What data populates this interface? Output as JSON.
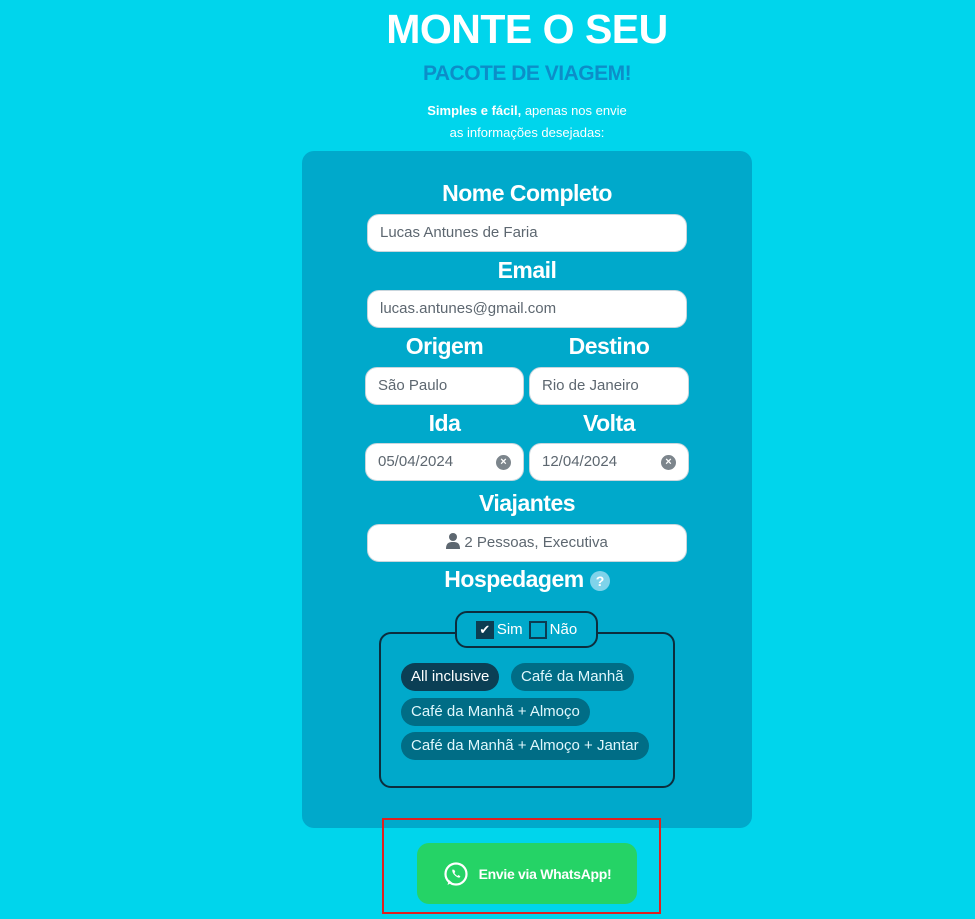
{
  "header": {
    "title": "MONTE O SEU",
    "subtitle": "PACOTE DE VIAGEM!",
    "tagline_bold": "Simples e fácil,",
    "tagline_rest": " apenas nos envie",
    "tagline_line2": "as informações desejadas:"
  },
  "form": {
    "name_label": "Nome Completo",
    "name_value": "Lucas Antunes de Faria",
    "email_label": "Email",
    "email_value": "lucas.antunes@gmail.com",
    "origin_label": "Origem",
    "origin_value": "São Paulo",
    "destination_label": "Destino",
    "destination_value": "Rio de Janeiro",
    "departure_label": "Ida",
    "departure_value": "05/04/2024",
    "return_label": "Volta",
    "return_value": "12/04/2024",
    "travelers_label": "Viajantes",
    "travelers_value": "2 Pessoas, Executiva",
    "lodging_label": "Hospedagem",
    "help_symbol": "?",
    "lodging_yes": "Sim",
    "lodging_no": "Não",
    "lodging_yes_checked": true,
    "lodging_no_checked": false,
    "meal_options": [
      {
        "label": "All inclusive",
        "selected": true
      },
      {
        "label": "Café da Manhã",
        "selected": false
      },
      {
        "label": "Café da Manhã + Almoço",
        "selected": false
      },
      {
        "label": "Café da Manhã + Almoço + Jantar",
        "selected": false
      }
    ]
  },
  "submit": {
    "label": "Envie via WhatsApp!",
    "icon": "whatsapp-icon",
    "color": "#25d366"
  },
  "colors": {
    "background": "#00d5ec",
    "card": "#00a9cb",
    "subtitle": "#0c8ec8",
    "highlight_box": "#e0201f"
  }
}
